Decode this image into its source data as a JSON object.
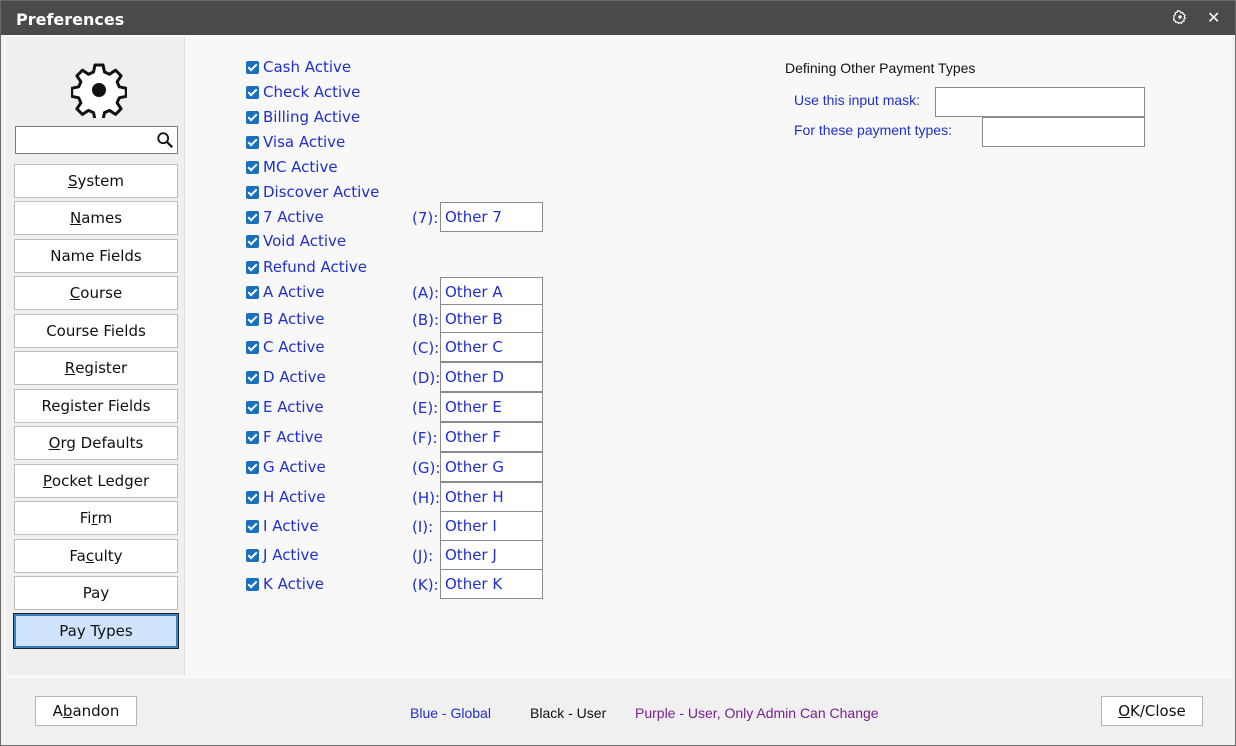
{
  "window": {
    "title": "Preferences",
    "icons": {
      "settings": "gear-icon",
      "close": "close-icon",
      "close_glyph": "✕"
    }
  },
  "sidebar": {
    "logo_icon": "gear-icon",
    "search": {
      "value": "",
      "icon": "search-icon"
    },
    "items": [
      {
        "label": "System",
        "ul": "S",
        "rest": "ystem",
        "active": false
      },
      {
        "label": "Names",
        "ul": "N",
        "rest": "ames",
        "active": false
      },
      {
        "label": "Name Fields",
        "active": false
      },
      {
        "label": "Course",
        "ul": "C",
        "rest": "ourse",
        "active": false
      },
      {
        "label": "Course Fields",
        "active": false
      },
      {
        "label": "Register",
        "ul": "R",
        "rest": "egister",
        "active": false
      },
      {
        "label": "Register Fields",
        "active": false
      },
      {
        "label": "Org Defaults",
        "pre": "",
        "ul": "O",
        "rest": "rg Defaults",
        "active": false
      },
      {
        "label": "Pocket Ledger",
        "ul": "P",
        "rest": "ocket Ledger",
        "active": false
      },
      {
        "label": "Firm",
        "pre": "Fi",
        "ul": "r",
        "rest": "m",
        "active": false
      },
      {
        "label": "Faculty",
        "pre": "Fa",
        "ul": "c",
        "rest": "ulty",
        "active": false
      },
      {
        "label": "Pay",
        "active": false
      },
      {
        "label": "Pay Types",
        "active": true
      }
    ]
  },
  "payment_types": [
    {
      "label": "Cash Active",
      "checked": true
    },
    {
      "label": "Check Active",
      "checked": true
    },
    {
      "label": "Billing Active",
      "checked": true
    },
    {
      "label": "Visa Active",
      "checked": true
    },
    {
      "label": "MC Active",
      "checked": true
    },
    {
      "label": "Discover Active",
      "checked": true
    },
    {
      "label": "7 Active",
      "checked": true,
      "code": "(7):",
      "value": "Other  7"
    },
    {
      "label": "Void Active",
      "checked": true
    },
    {
      "label": "Refund Active",
      "checked": true
    },
    {
      "label": "A Active",
      "checked": true,
      "code": "(A):",
      "value": "Other  A"
    },
    {
      "label": "B Active",
      "checked": true,
      "code": "(B):",
      "value": "Other  B"
    },
    {
      "label": "C Active",
      "checked": true,
      "code": "(C):",
      "value": "Other C"
    },
    {
      "label": "D Active",
      "checked": true,
      "code": "(D):",
      "value": "Other D"
    },
    {
      "label": "E Active",
      "checked": true,
      "code": "(E):",
      "value": "Other E"
    },
    {
      "label": "F Active",
      "checked": true,
      "code": "(F):",
      "value": "Other F"
    },
    {
      "label": "G Active",
      "checked": true,
      "code": "(G):",
      "value": "Other G"
    },
    {
      "label": "H Active",
      "checked": true,
      "code": "(H):",
      "value": "Other H"
    },
    {
      "label": "I Active",
      "checked": true,
      "code": "(I):",
      "value": "Other I"
    },
    {
      "label": "J Active",
      "checked": true,
      "code": "(J):",
      "value": "Other J"
    },
    {
      "label": "K Active",
      "checked": true,
      "code": "(K):",
      "value": "Other K"
    }
  ],
  "other_types": {
    "title": "Defining Other Payment Types",
    "mask_label": "Use this input mask:",
    "mask_value": "",
    "types_label": "For these payment types:",
    "types_value": ""
  },
  "footer": {
    "abandon": {
      "label": "Abandon",
      "pre": "A",
      "ul": "b",
      "rest": "andon"
    },
    "ok": {
      "label": "OK/Close",
      "pre": "",
      "ul": "O",
      "rest": "K/Close"
    },
    "legend": [
      {
        "text": "Blue - Global",
        "color": "#1f2fd0"
      },
      {
        "text": "Black - User",
        "color": "#111111"
      },
      {
        "text": "Purple - User, Only Admin Can Change",
        "color": "#7a1f8f"
      }
    ]
  },
  "colors": {
    "global_text": "#1f2fd0",
    "accent": "#1a6fbf",
    "titlebar": "#4a4a4a"
  }
}
